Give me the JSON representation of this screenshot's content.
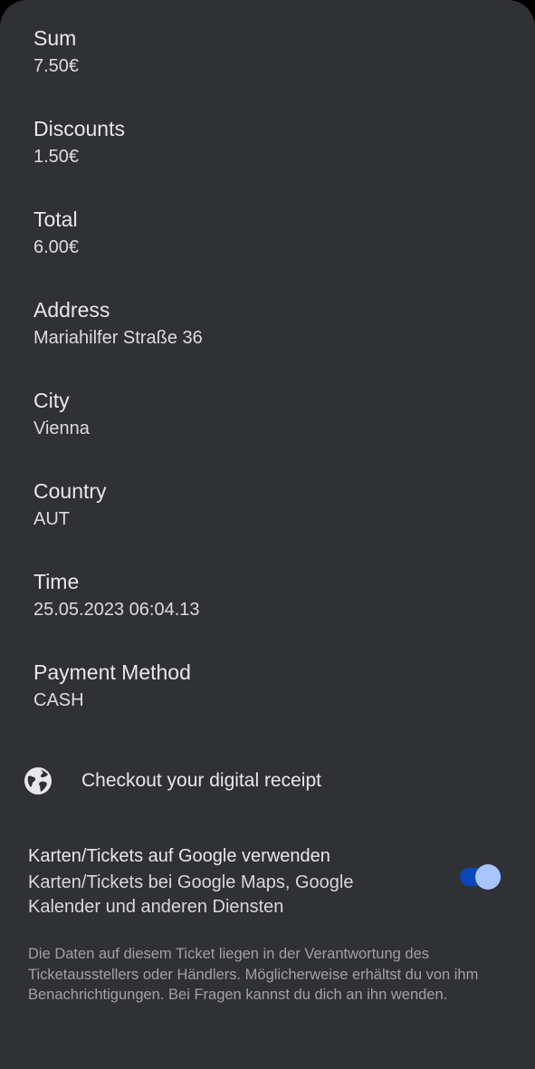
{
  "fields": [
    {
      "label": "Sum",
      "value": "7.50€"
    },
    {
      "label": "Discounts",
      "value": "1.50€"
    },
    {
      "label": "Total",
      "value": "6.00€"
    },
    {
      "label": "Address",
      "value": "Mariahilfer Straße 36"
    },
    {
      "label": "City",
      "value": "Vienna"
    },
    {
      "label": "Country",
      "value": "AUT"
    },
    {
      "label": "Time",
      "value": "25.05.2023 06:04.13"
    },
    {
      "label": "Payment Method",
      "value": "CASH"
    }
  ],
  "receipt_link": {
    "icon": "globe-icon",
    "label": "Checkout your digital receipt"
  },
  "google_setting": {
    "title": "Karten/Tickets auf Google verwenden",
    "description": "Karten/Tickets bei Google Maps, Google Kalender und anderen Diensten",
    "toggle_on": true
  },
  "disclaimer": "Die Daten auf diesem Ticket liegen in der Verantwortung des Ticketausstellers oder Händlers. Möglicherweise erhältst du von ihm Benachrichtigungen. Bei Fragen kannst du dich an ihn wenden.",
  "colors": {
    "sheet_background": "#303134",
    "toggle_track": "#0b47b8",
    "toggle_thumb": "#a9c4ff"
  }
}
